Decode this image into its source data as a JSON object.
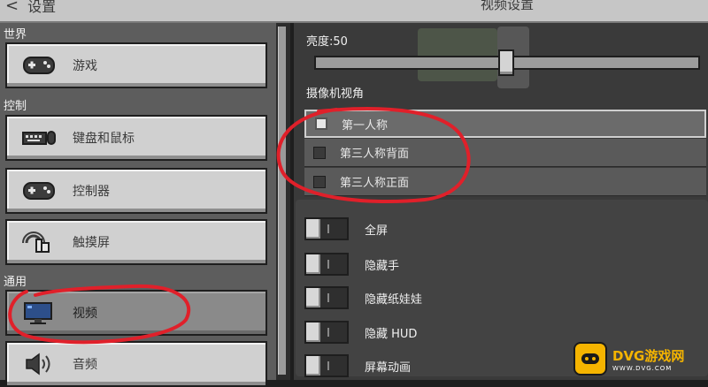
{
  "header": {
    "back_label": "设置",
    "back_chevron": "<",
    "page_title": "视频设置"
  },
  "sidebar": {
    "groups": [
      {
        "title": "世界"
      },
      {
        "title": "控制"
      },
      {
        "title": "通用"
      }
    ],
    "items": [
      {
        "label": "游戏",
        "icon": "gamepad-icon"
      },
      {
        "label": "键盘和鼠标",
        "icon": "keyboard-mouse-icon"
      },
      {
        "label": "控制器",
        "icon": "controller-icon"
      },
      {
        "label": "触摸屏",
        "icon": "touch-screen-icon"
      },
      {
        "label": "视频",
        "icon": "monitor-icon",
        "selected": true
      },
      {
        "label": "音频",
        "icon": "speaker-icon"
      }
    ]
  },
  "video": {
    "brightness_label": "亮度:50",
    "brightness_value": 50,
    "camera_label": "摄像机视角",
    "camera_options": [
      {
        "label": "第一人称",
        "selected": true
      },
      {
        "label": "第三人称背面",
        "selected": false
      },
      {
        "label": "第三人称正面",
        "selected": false
      }
    ],
    "toggles": [
      {
        "label": "全屏",
        "on": false
      },
      {
        "label": "隐藏手",
        "on": false
      },
      {
        "label": "隐藏纸娃娃",
        "on": false
      },
      {
        "label": "隐藏 HUD",
        "on": false
      },
      {
        "label": "屏幕动画",
        "on": false
      }
    ]
  },
  "watermark": {
    "name": "DVG游戏网",
    "url": "WWW.DVG.COM"
  },
  "colors": {
    "annotation": "#e0202a",
    "watermark": "#f5b400"
  }
}
